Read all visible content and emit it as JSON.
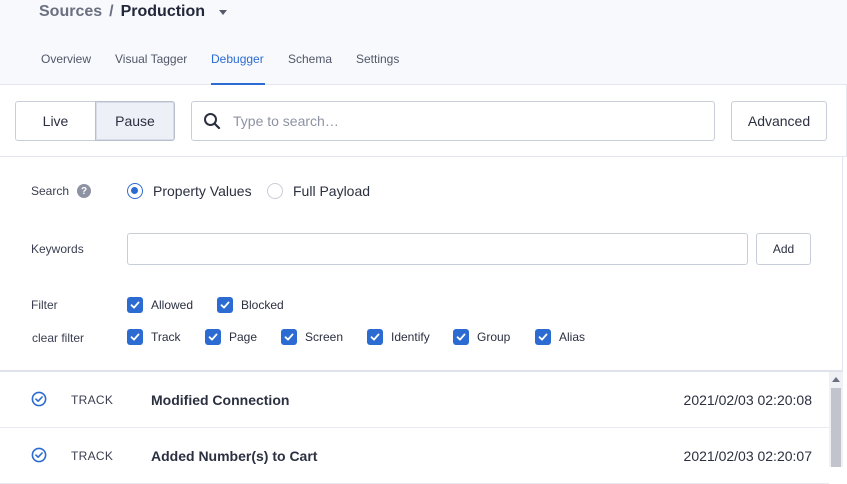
{
  "breadcrumb": {
    "source": "Sources",
    "separator": "/",
    "current": "Production"
  },
  "tabs": [
    {
      "label": "Overview",
      "active": false
    },
    {
      "label": "Visual Tagger",
      "active": false
    },
    {
      "label": "Debugger",
      "active": true
    },
    {
      "label": "Schema",
      "active": false
    },
    {
      "label": "Settings",
      "active": false
    }
  ],
  "toolbar": {
    "live_label": "Live",
    "pause_label": "Pause",
    "search_placeholder": "Type to search…",
    "advanced_label": "Advanced"
  },
  "panel": {
    "search_label": "Search",
    "help_glyph": "?",
    "radio_property": "Property Values",
    "radio_payload": "Full Payload",
    "keywords_label": "Keywords",
    "keywords_value": "",
    "add_label": "Add",
    "filter_label": "Filter",
    "clear_filter_label": "clear filter",
    "filter_options": [
      "Allowed",
      "Blocked"
    ],
    "type_options": [
      "Track",
      "Page",
      "Screen",
      "Identify",
      "Group",
      "Alias"
    ]
  },
  "events": [
    {
      "type": "TRACK",
      "name": "Modified Connection",
      "time": "2021/02/03 02:20:08"
    },
    {
      "type": "TRACK",
      "name": "Added Number(s) to Cart",
      "time": "2021/02/03 02:20:07"
    }
  ],
  "colors": {
    "accent": "#2c6bd1",
    "header_bg": "#f8f9fc"
  }
}
